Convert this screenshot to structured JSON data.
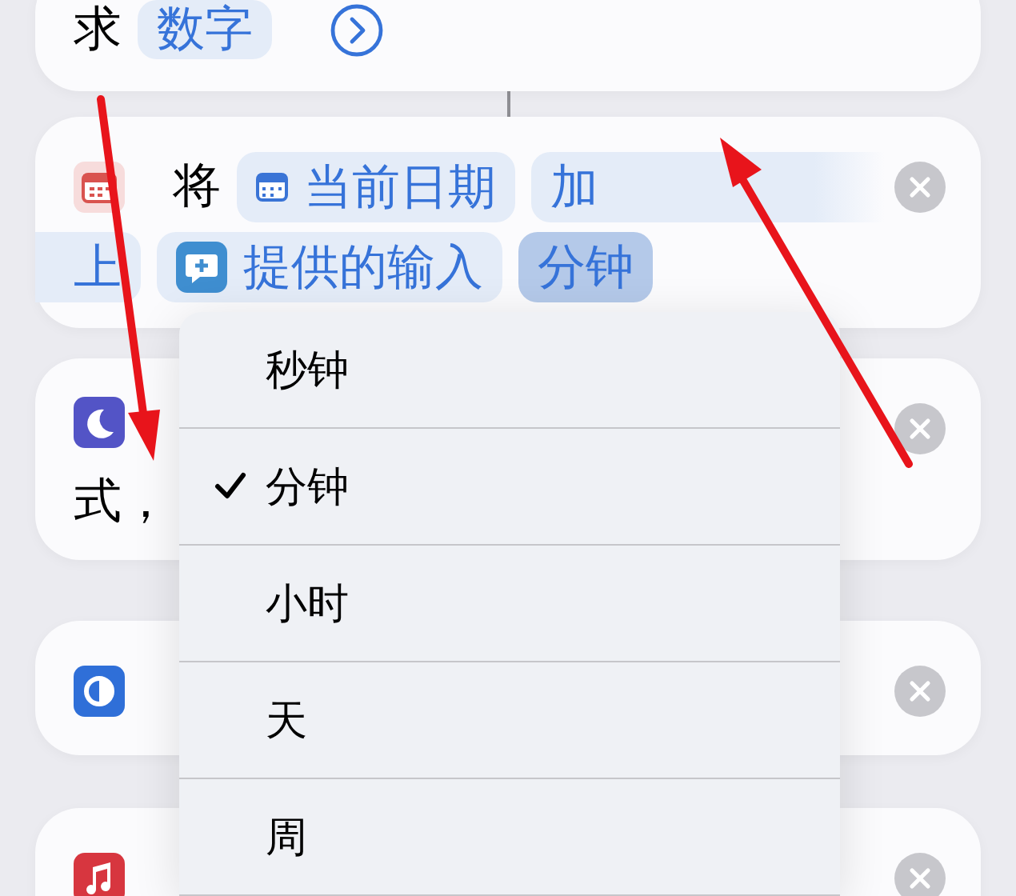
{
  "cards": [
    {
      "kind": "math",
      "deletable": false,
      "lines": [
        [
          {
            "kind": "text",
            "text": "求"
          },
          {
            "kind": "variable",
            "text": "数字",
            "selected": false
          },
          {
            "kind": "more"
          }
        ]
      ]
    },
    {
      "kind": "calendar",
      "deletable": true,
      "lines": [
        [
          {
            "kind": "text",
            "text": "将"
          },
          {
            "kind": "date-variable",
            "text": "当前日期",
            "selected": false
          },
          {
            "kind": "continued-start",
            "text": "加",
            "selected": false
          }
        ],
        [
          {
            "kind": "continued-end",
            "text": "上",
            "selected": false
          },
          {
            "kind": "input-variable",
            "text": "提供的输入",
            "selected": false
          },
          {
            "kind": "variable",
            "text": "分钟",
            "selected": true
          }
        ]
      ]
    },
    {
      "kind": "moon",
      "deletable": true,
      "lines": [
        [
          {
            "kind": "text",
            "text": "式，"
          }
        ]
      ]
    },
    {
      "kind": "focus",
      "deletable": true
    },
    {
      "kind": "music",
      "deletable": true
    }
  ],
  "menu": {
    "items": [
      {
        "label": "秒钟",
        "selected": false
      },
      {
        "label": "分钟",
        "selected": true
      },
      {
        "label": "小时",
        "selected": false
      },
      {
        "label": "天",
        "selected": false
      },
      {
        "label": "周",
        "selected": false
      }
    ]
  }
}
